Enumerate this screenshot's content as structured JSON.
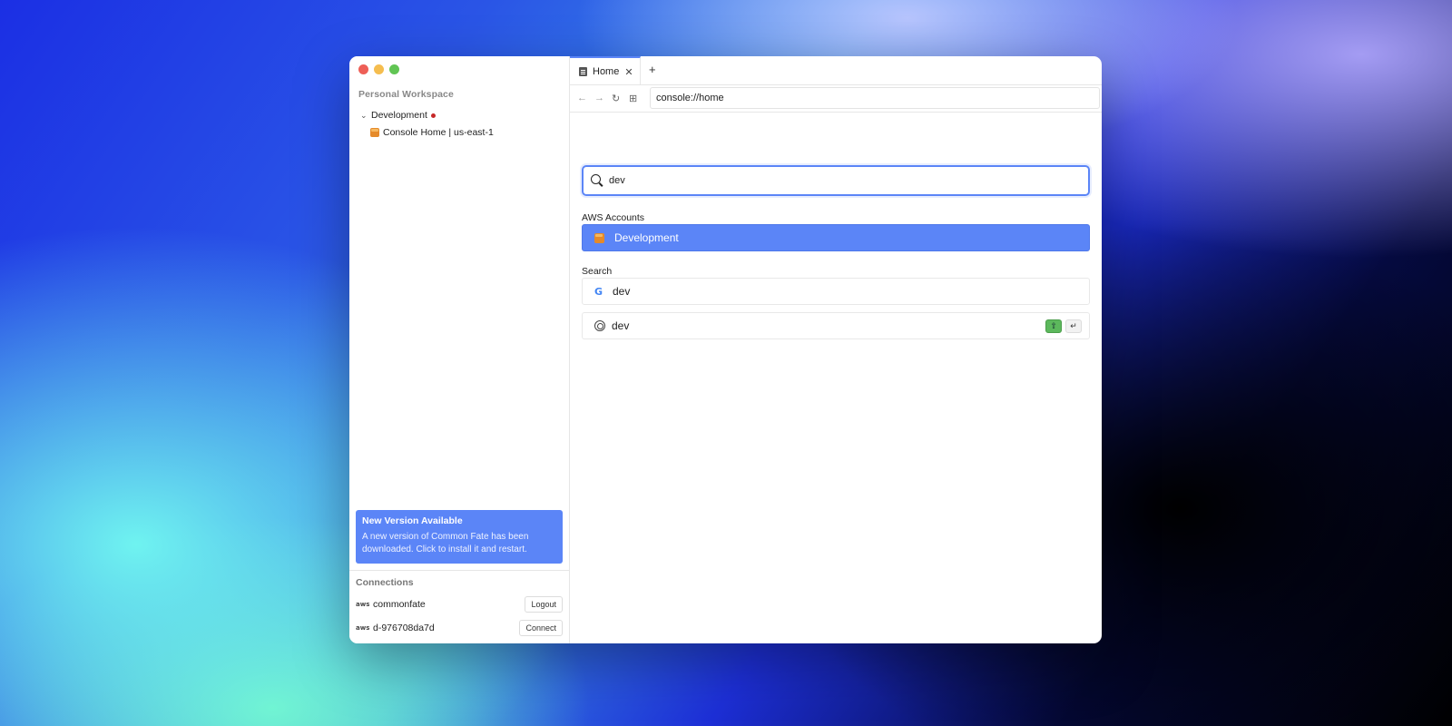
{
  "sidebar": {
    "workspace_title": "Personal Workspace",
    "tree": {
      "group_label": "Development",
      "items": [
        {
          "label": "Console Home | us-east-1"
        }
      ]
    },
    "notice": {
      "title": "New Version Available",
      "text": "A new version of Common Fate has been downloaded. Click to install it and restart."
    },
    "connections": {
      "title": "Connections",
      "items": [
        {
          "icon": "aws",
          "name": "commonfate",
          "action": "Logout"
        },
        {
          "icon": "aws",
          "name": "d-976708da7d",
          "action": "Connect"
        }
      ]
    }
  },
  "tabs": [
    {
      "label": "Home",
      "close": "✕"
    }
  ],
  "tab_add": "+",
  "nav": {
    "back": "←",
    "forward": "→",
    "reload": "↻",
    "extension": "⊞",
    "url": "console://home"
  },
  "search": {
    "query": "dev",
    "sections": {
      "accounts_label": "AWS Accounts",
      "search_label": "Search"
    },
    "account_results": [
      {
        "label": "Development"
      }
    ],
    "search_results": [
      {
        "icon": "G",
        "label": "dev"
      },
      {
        "label": "dev",
        "keys": [
          "⇧",
          "↵"
        ]
      }
    ]
  },
  "colors": {
    "accent": "#5b85f7",
    "close_dot": "#ee5f57",
    "minimize_dot": "#f5bd4f",
    "zoom_dot": "#61c554",
    "status_dot": "#c62828",
    "shortcut_green": "#5cb85c"
  }
}
